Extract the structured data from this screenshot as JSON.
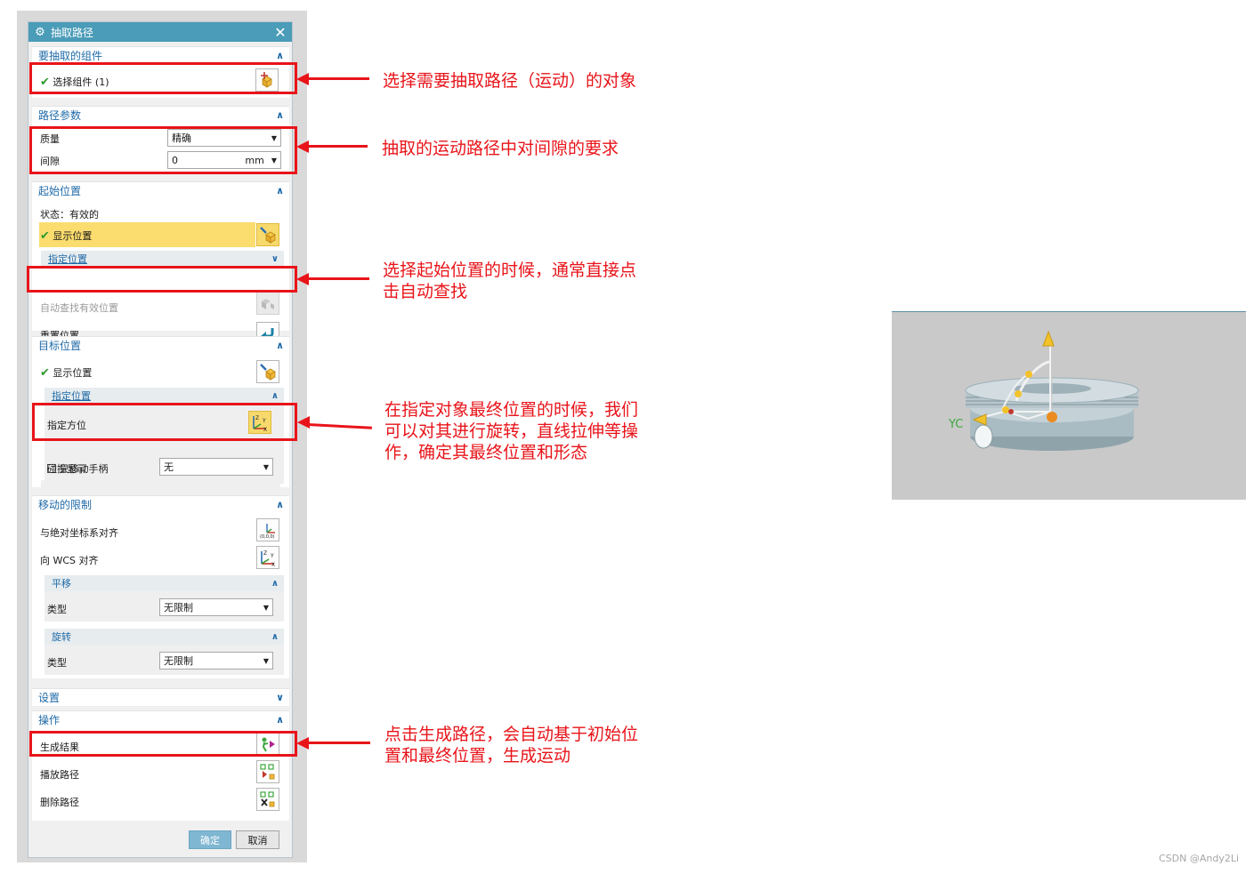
{
  "dialog": {
    "title": "抽取路径",
    "close_symbol": "✕",
    "components_group": {
      "header": "要抽取的组件",
      "select_component": "选择组件 (1)"
    },
    "path_params": {
      "header": "路径参数",
      "quality_label": "质量",
      "quality_value": "精确",
      "gap_label": "间隙",
      "gap_value": "0",
      "gap_unit": "mm"
    },
    "start_position": {
      "header": "起始位置",
      "status": "状态：有效的",
      "show_position": "显示位置",
      "specify_position": "指定位置",
      "auto_find": "自动查找有效位置",
      "reset_position": "重置位置"
    },
    "target_position": {
      "header": "目标位置",
      "show_position": "显示位置",
      "specify_position": "指定位置",
      "specify_orientation": "指定方位",
      "move_handle_only": "只移动手柄",
      "collision_label": "碰撞显示",
      "collision_value": "无"
    },
    "motion_limits": {
      "header": "移动的限制",
      "align_abs": "与绝对坐标系对齐",
      "align_wcs": "向 WCS 对齐",
      "translate": {
        "header": "平移",
        "type_label": "类型",
        "type_value": "无限制"
      },
      "rotate": {
        "header": "旋转",
        "type_label": "类型",
        "type_value": "无限制"
      }
    },
    "settings": {
      "header": "设置"
    },
    "operations": {
      "header": "操作",
      "generate": "生成结果",
      "play": "播放路径",
      "delete": "删除路径"
    },
    "ok": "确定",
    "cancel": "取消"
  },
  "annotations": {
    "a1": "选择需要抽取路径（运动）的对象",
    "a2": "抽取的运动路径中对间隙的要求",
    "a3": "选择起始位置的时候，通常直接点\n击自动查找",
    "a4": "在指定对象最终位置的时候，我们\n可以对其进行旋转，直线拉伸等操\n作，确定其最终位置和形态",
    "a5": "点击生成路径，会自动基于初始位\n置和最终位置，生成运动"
  },
  "viewport": {
    "axis_label": "YC"
  },
  "watermark": "CSDN @Andy2Li",
  "colors": {
    "accent": "#4a9cb8",
    "annotation": "#e8141a",
    "highlight": "#f7d96c"
  }
}
